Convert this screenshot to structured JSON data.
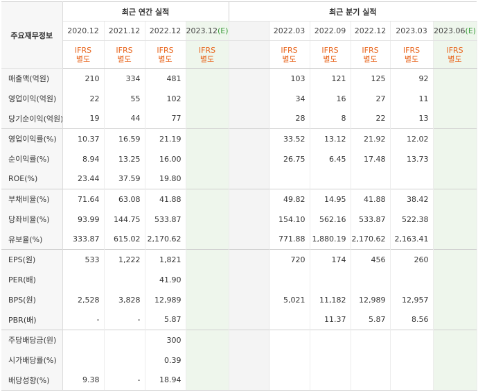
{
  "table": {
    "corner_label": "주요재무정보",
    "annual_title": "최근 연간 실적",
    "quarter_title": "최근 분기 실적",
    "annual_periods": [
      {
        "label": "2020.12",
        "est": ""
      },
      {
        "label": "2021.12",
        "est": ""
      },
      {
        "label": "2022.12",
        "est": ""
      },
      {
        "label": "2023.12",
        "est": "(E)"
      }
    ],
    "quarter_periods": [
      {
        "label": "2022.03",
        "est": ""
      },
      {
        "label": "2022.09",
        "est": ""
      },
      {
        "label": "2022.12",
        "est": ""
      },
      {
        "label": "2023.03",
        "est": ""
      },
      {
        "label": "2023.06",
        "est": "(E)"
      }
    ],
    "ifrs_line1": "IFRS",
    "ifrs_line2": "별도",
    "rows": [
      {
        "label": "매출액(억원)",
        "annual": [
          "210",
          "334",
          "481",
          ""
        ],
        "quarter": [
          "103",
          "121",
          "125",
          "92",
          ""
        ]
      },
      {
        "label": "영업이익(억원)",
        "annual": [
          "22",
          "55",
          "102",
          ""
        ],
        "quarter": [
          "34",
          "16",
          "27",
          "11",
          ""
        ]
      },
      {
        "label": "당기순이익(억원)",
        "annual": [
          "19",
          "44",
          "77",
          ""
        ],
        "quarter": [
          "28",
          "8",
          "22",
          "13",
          ""
        ]
      },
      {
        "label": "영업이익률(%)",
        "annual": [
          "10.37",
          "16.59",
          "21.19",
          ""
        ],
        "quarter": [
          "33.52",
          "13.12",
          "21.92",
          "12.02",
          ""
        ]
      },
      {
        "label": "순이익률(%)",
        "annual": [
          "8.94",
          "13.25",
          "16.00",
          ""
        ],
        "quarter": [
          "26.75",
          "6.45",
          "17.48",
          "13.73",
          ""
        ]
      },
      {
        "label": "ROE(%)",
        "annual": [
          "23.44",
          "37.59",
          "19.80",
          ""
        ],
        "quarter": [
          "",
          "",
          "",
          "",
          ""
        ]
      },
      {
        "label": "부채비율(%)",
        "annual": [
          "71.64",
          "63.08",
          "41.88",
          ""
        ],
        "quarter": [
          "49.82",
          "14.95",
          "41.88",
          "38.42",
          ""
        ]
      },
      {
        "label": "당좌비율(%)",
        "annual": [
          "93.99",
          "144.75",
          "533.87",
          ""
        ],
        "quarter": [
          "154.10",
          "562.16",
          "533.87",
          "522.38",
          ""
        ]
      },
      {
        "label": "유보율(%)",
        "annual": [
          "333.87",
          "615.02",
          "2,170.62",
          ""
        ],
        "quarter": [
          "771.88",
          "1,880.19",
          "2,170.62",
          "2,163.41",
          ""
        ]
      },
      {
        "label": "EPS(원)",
        "annual": [
          "533",
          "1,222",
          "1,821",
          ""
        ],
        "quarter": [
          "720",
          "174",
          "456",
          "260",
          ""
        ]
      },
      {
        "label": "PER(배)",
        "annual": [
          "",
          "",
          "41.90",
          ""
        ],
        "quarter": [
          "",
          "",
          "",
          "",
          ""
        ]
      },
      {
        "label": "BPS(원)",
        "annual": [
          "2,528",
          "3,828",
          "12,989",
          ""
        ],
        "quarter": [
          "5,021",
          "11,182",
          "12,989",
          "12,957",
          ""
        ]
      },
      {
        "label": "PBR(배)",
        "annual": [
          "-",
          "-",
          "5.87",
          ""
        ],
        "quarter": [
          "",
          "11.37",
          "5.87",
          "8.56",
          ""
        ]
      },
      {
        "label": "주당배당금(원)",
        "annual": [
          "",
          "",
          "300",
          ""
        ],
        "quarter": [
          "",
          "",
          "",
          "",
          ""
        ]
      },
      {
        "label": "시가배당률(%)",
        "annual": [
          "",
          "",
          "0.39",
          ""
        ],
        "quarter": [
          "",
          "",
          "",
          "",
          ""
        ]
      },
      {
        "label": "배당성향(%)",
        "annual": [
          "9.38",
          "-",
          "18.94",
          ""
        ],
        "quarter": [
          "",
          "",
          "",
          "",
          ""
        ]
      }
    ]
  },
  "colors": {
    "ifrs": "#e8641b",
    "estimate_bg": "#eef6ec",
    "estimate_mark": "#3a9a3a",
    "label_bg": "#f7f7f7"
  }
}
